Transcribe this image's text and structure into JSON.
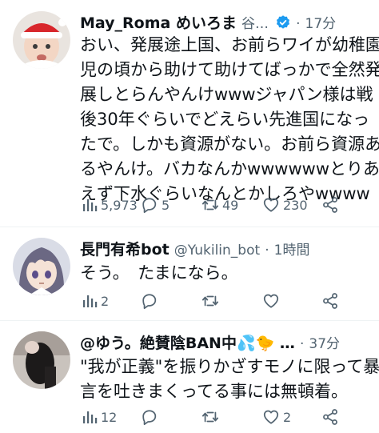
{
  "colors": {
    "text": "#0f1419",
    "muted": "#536471",
    "verified": "#1d9bf0",
    "divider": "#eff3f4"
  },
  "tweets": [
    {
      "display_name": "May_Roma めいろま",
      "handle": "谷…",
      "time": "17分",
      "verified": true,
      "avatar_icon": "baby-santa-hat-avatar",
      "body_lines": [
        "おい、発展途上国、お前らワイが幼稚園",
        "児の頃から助けて助けてばっかで全然発",
        "展しとらんやんけwwwジャパン様は戦",
        "後30年ぐらいでどえらい先進国になっ",
        "たで。しかも資源がない。お前ら資源あ",
        "るやんけ。バカなんかwwwwwwとりあ",
        "えず下水ぐらいなんとかしろやwwww"
      ],
      "views": "5,973",
      "replies": "5",
      "retweets": "49",
      "likes": "230"
    },
    {
      "display_name": "長門有希bot",
      "handle": "@Yukilin_bot",
      "time": "1時間",
      "verified": false,
      "avatar_icon": "anime-girl-avatar",
      "body_lines": [
        "そう。　たまになら。"
      ],
      "views": "2",
      "replies": "",
      "retweets": "",
      "likes": ""
    },
    {
      "display_name": "@ゆう。絶賛陰BAN中💦🐤 …",
      "handle": "",
      "time": "37分",
      "verified": false,
      "avatar_icon": "person-photo-avatar",
      "body_lines": [
        "\"我が正義\"を振りかざすモノに限って暴",
        "言を吐きまくってる事には無頓着。"
      ],
      "views": "12",
      "replies": "",
      "retweets": "",
      "likes": "2"
    }
  ]
}
